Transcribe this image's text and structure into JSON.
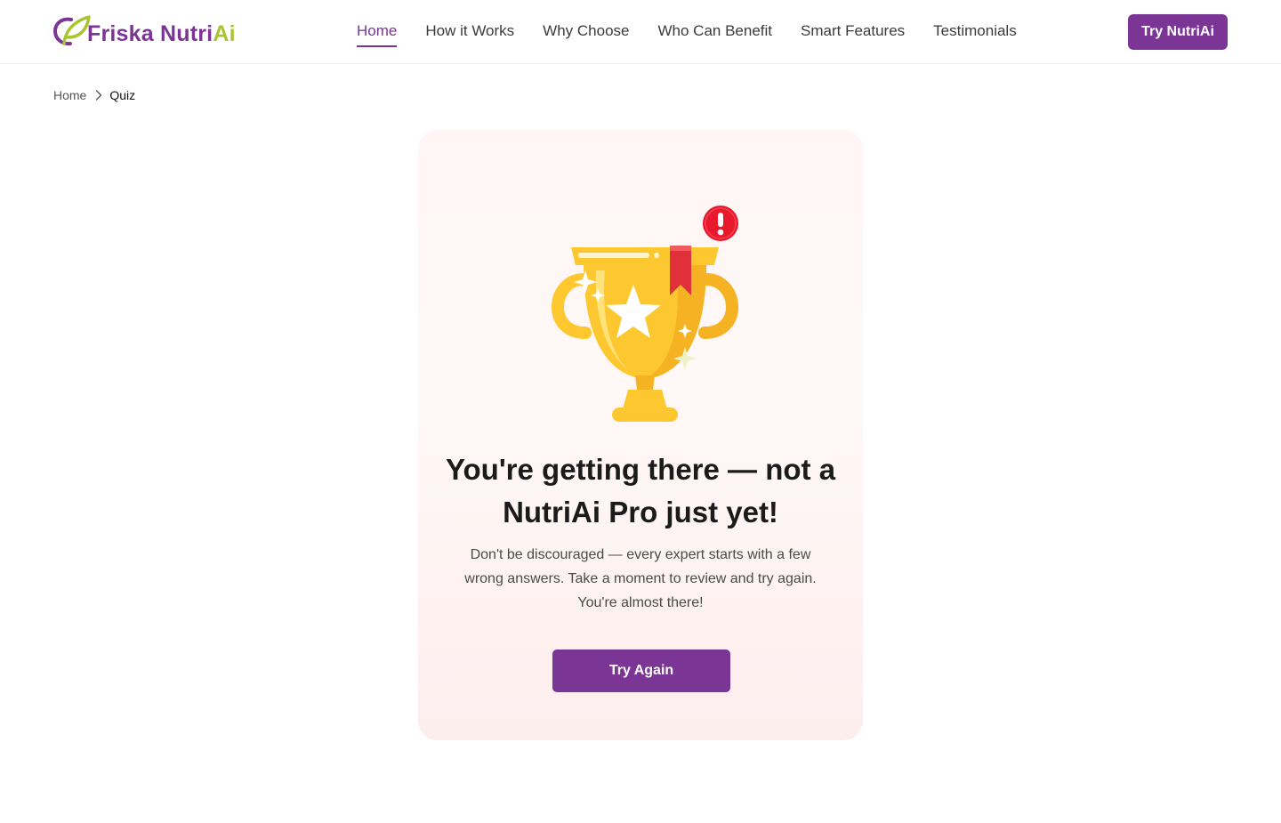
{
  "header": {
    "logo": {
      "brand_text": "Friska Nutri",
      "accent_text": "Ai"
    },
    "nav": [
      {
        "label": "Home",
        "active": true
      },
      {
        "label": "How it Works",
        "active": false
      },
      {
        "label": "Why Choose",
        "active": false
      },
      {
        "label": "Who Can Benefit",
        "active": false
      },
      {
        "label": "Smart Features",
        "active": false
      },
      {
        "label": "Testimonials",
        "active": false
      }
    ],
    "cta_label": "Try NutriAi"
  },
  "breadcrumb": {
    "home": "Home",
    "current": "Quiz"
  },
  "result": {
    "headline": "You're getting there — not a NutriAi Pro just yet!",
    "message": "Don't be discouraged — every expert starts with a few wrong answers. Take a moment to review and try again. You're almost there!",
    "button_label": "Try Again"
  },
  "colors": {
    "brand_purple": "#7b3594",
    "accent_green": "#a8c531",
    "trophy_gold": "#fdc82f",
    "alert_red": "#e8192c"
  },
  "icons": [
    "leaf-logo-icon",
    "chevron-right-icon",
    "trophy-icon",
    "star-icon",
    "bookmark-ribbon-icon",
    "alert-icon"
  ]
}
